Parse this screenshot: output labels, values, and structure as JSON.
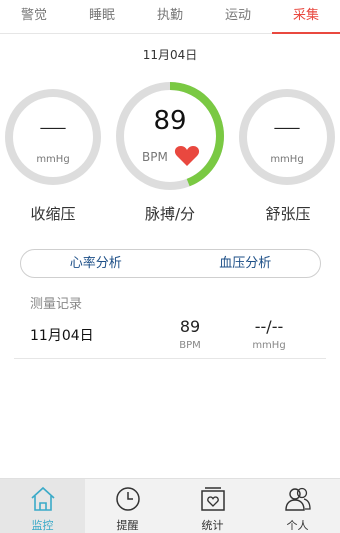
{
  "tabs": [
    {
      "label": "警觉",
      "active": false
    },
    {
      "label": "睡眠",
      "active": false
    },
    {
      "label": "执勤",
      "active": false
    },
    {
      "label": "运动",
      "active": false
    },
    {
      "label": "采集",
      "active": true
    }
  ],
  "date": "11月04日",
  "gauges": {
    "systolic": {
      "value": "—",
      "unit": "mmHg",
      "label": "收缩压"
    },
    "pulse": {
      "value": "89",
      "unit": "BPM",
      "label": "脉搏/分",
      "progress": 0.44
    },
    "diastolic": {
      "value": "—",
      "unit": "mmHg",
      "label": "舒张压"
    }
  },
  "buttons": {
    "heart_rate": "心率分析",
    "blood_pressure": "血压分析"
  },
  "records": {
    "title": "测量记录",
    "items": [
      {
        "date": "11月04日",
        "pulse": "89",
        "pulse_unit": "BPM",
        "pressure": "--/--",
        "pressure_unit": "mmHg"
      }
    ]
  },
  "nav": [
    {
      "label": "监控",
      "icon": "home-icon",
      "active": true
    },
    {
      "label": "提醒",
      "icon": "clock-icon",
      "active": false
    },
    {
      "label": "统计",
      "icon": "stats-icon",
      "active": false
    },
    {
      "label": "个人",
      "icon": "person-icon",
      "active": false
    }
  ],
  "colors": {
    "accent": "#e9483f",
    "progress": "#7ac943",
    "ring": "#dddddd",
    "heart": "#e9483f",
    "nav_active": "#3aaac8",
    "button_text": "#1d4f87"
  }
}
